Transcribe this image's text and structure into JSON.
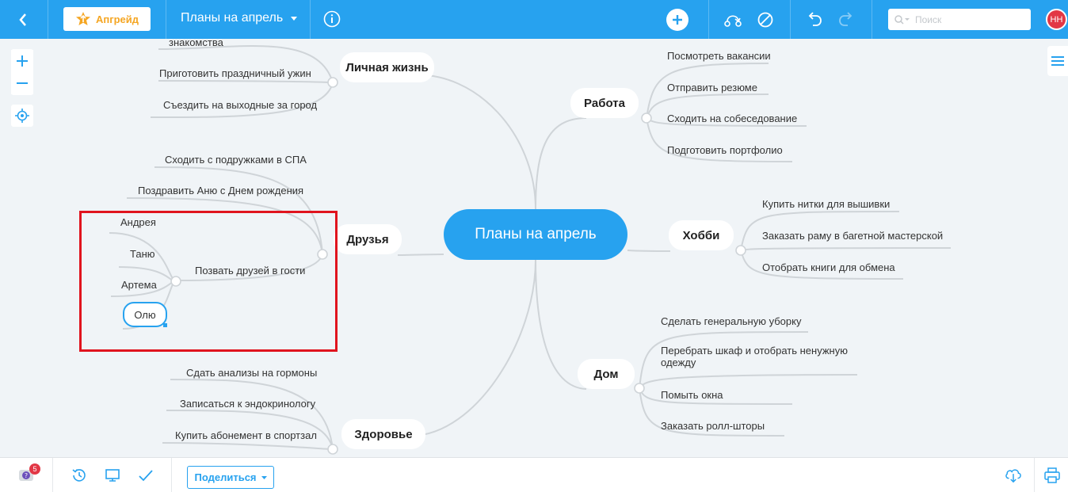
{
  "topbar": {
    "upgrade_label": "Апгрейд",
    "map_title": "Планы на апрель",
    "search_placeholder": "Поиск",
    "avatar_initials": "НН"
  },
  "mindmap": {
    "central": "Планы на апрель",
    "branches": {
      "personal": {
        "label": "Личная жизнь",
        "items": [
          "знакомства",
          "Приготовить праздничный ужин",
          "Съездить на выходные за город"
        ]
      },
      "friends": {
        "label": "Друзья",
        "items": [
          "Сходить с подружками в СПА",
          "Поздравить Аню с Днем рождения",
          "Позвать друзей в гости"
        ],
        "invite_children": [
          "Андрея",
          "Таню",
          "Артема",
          "Олю"
        ]
      },
      "health": {
        "label": "Здоровье",
        "items": [
          "Сдать анализы на гормоны",
          "Записаться к эндокринологу",
          "Купить абонемент в спортзал"
        ]
      },
      "work": {
        "label": "Работа",
        "items": [
          "Посмотреть вакансии",
          "Отправить резюме",
          "Сходить на собеседование",
          "Подготовить портфолио"
        ]
      },
      "hobby": {
        "label": "Хобби",
        "items": [
          "Купить нитки для вышивки",
          "Заказать раму в багетной мастерской",
          "Отобрать книги для обмена"
        ]
      },
      "home": {
        "label": "Дом",
        "items": [
          "Сделать генеральную уборку",
          "Перебрать шкаф и отобрать ненужную одежду",
          "Помыть окна",
          "Заказать ролл-шторы"
        ]
      }
    }
  },
  "bottombar": {
    "notifications_count": "5",
    "share_label": "Поделиться"
  },
  "colors": {
    "accent": "#27a2ef",
    "highlight": "#e0141e",
    "badge": "#e23745",
    "upgrade": "#f5a623"
  }
}
